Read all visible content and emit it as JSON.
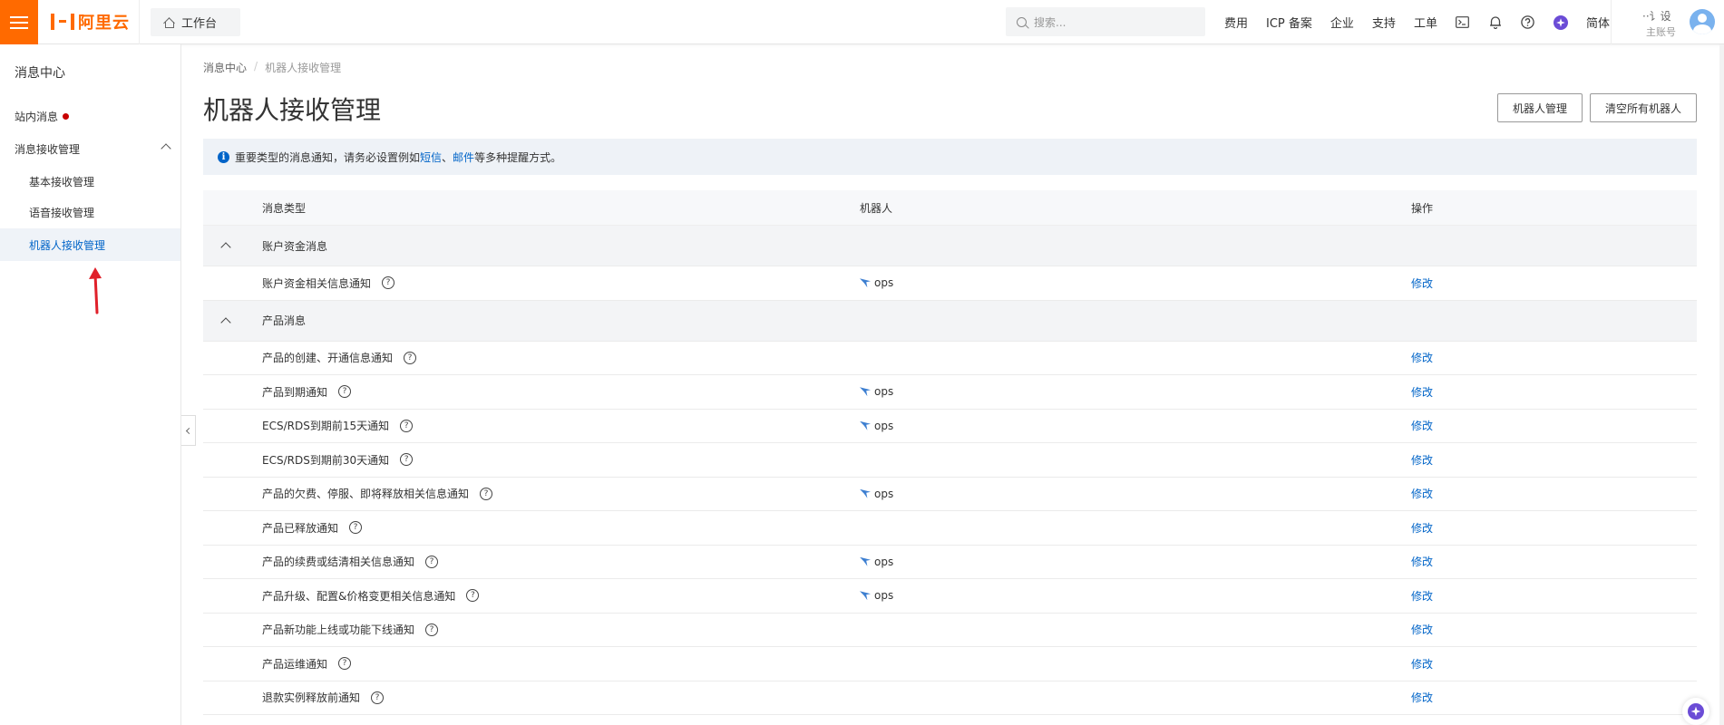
{
  "topbar": {
    "brand": "阿里云",
    "workbench": "工作台",
    "search_placeholder": "搜索...",
    "nav": [
      "费用",
      "ICP 备案",
      "企业",
      "支持",
      "工单"
    ],
    "lang": "简体",
    "user_name": "··讠设",
    "user_sub": "主账号",
    "brand_color": "#ff6a00"
  },
  "sidebar": {
    "title": "消息中心",
    "items": [
      {
        "label": "站内消息"
      },
      {
        "label": "消息接收管理"
      },
      {
        "label": "基本接收管理"
      },
      {
        "label": "语音接收管理"
      },
      {
        "label": "机器人接收管理"
      }
    ]
  },
  "main": {
    "breadcrumb": [
      "消息中心",
      "/",
      "机器人接收管理"
    ],
    "title": "机器人接收管理",
    "btn_robot_manage": "机器人管理",
    "btn_clear_all": "清空所有机器人",
    "notice": {
      "prefix": "重要类型的消息通知，请务必设置例如",
      "link1": "短信",
      "sep": "、",
      "link2": "邮件",
      "suffix": "等多种提醒方式。"
    },
    "table": {
      "headers": [
        "消息类型",
        "机器人",
        "操作"
      ],
      "groups": [
        {
          "name": "账户资金消息",
          "rows": [
            {
              "type": "账户资金相关信息通知",
              "robot": "ops",
              "op": "修改"
            }
          ]
        },
        {
          "name": "产品消息",
          "rows": [
            {
              "type": "产品的创建、开通信息通知",
              "robot": "",
              "op": "修改"
            },
            {
              "type": "产品到期通知",
              "robot": "ops",
              "op": "修改"
            },
            {
              "type": "ECS/RDS到期前15天通知",
              "robot": "ops",
              "op": "修改"
            },
            {
              "type": "ECS/RDS到期前30天通知",
              "robot": "",
              "op": "修改"
            },
            {
              "type": "产品的欠费、停服、即将释放相关信息通知",
              "robot": "ops",
              "op": "修改"
            },
            {
              "type": "产品已释放通知",
              "robot": "",
              "op": "修改"
            },
            {
              "type": "产品的续费或结清相关信息通知",
              "robot": "ops",
              "op": "修改"
            },
            {
              "type": "产品升级、配置&价格变更相关信息通知",
              "robot": "ops",
              "op": "修改"
            },
            {
              "type": "产品新功能上线或功能下线通知",
              "robot": "",
              "op": "修改"
            },
            {
              "type": "产品运维通知",
              "robot": "",
              "op": "修改"
            },
            {
              "type": "退款实例释放前通知",
              "robot": "",
              "op": "修改"
            }
          ]
        }
      ]
    }
  }
}
